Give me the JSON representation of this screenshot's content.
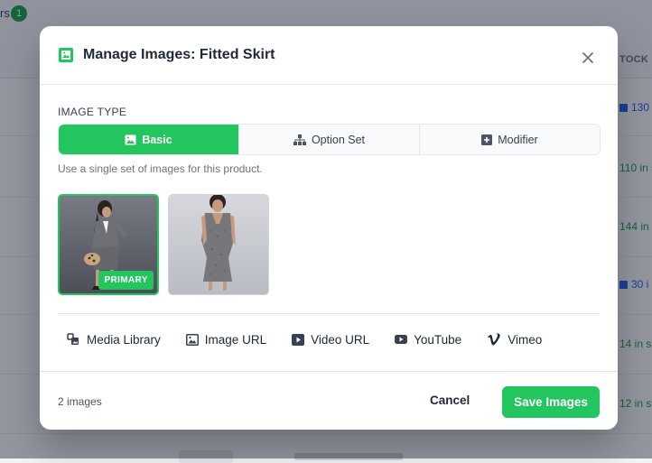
{
  "background": {
    "top_label_fragment": "rs",
    "count_badge": "1",
    "stock_header": "TOCK",
    "rows": [
      {
        "stock": "130",
        "kind": "variants"
      },
      {
        "stock": "110 in s",
        "kind": "in_stock"
      },
      {
        "stock": "144 in",
        "kind": "in_stock"
      },
      {
        "stock": "30 i",
        "kind": "variants"
      },
      {
        "stock": "14 in s",
        "kind": "in_stock"
      },
      {
        "stock": "12 in st",
        "kind": "in_stock"
      }
    ]
  },
  "modal": {
    "title": "Manage Images: Fitted Skirt",
    "close_icon": "close-icon",
    "image_type_label": "IMAGE TYPE",
    "tabs": [
      {
        "label": "Basic",
        "icon": "image-icon",
        "active": true
      },
      {
        "label": "Option Set",
        "icon": "hierarchy-icon",
        "active": false
      },
      {
        "label": "Modifier",
        "icon": "plus-square-icon",
        "active": false
      }
    ],
    "hint": "Use a single set of images for this product.",
    "images": [
      {
        "badge": "PRIMARY",
        "primary": true
      },
      {
        "badge": "",
        "primary": false
      }
    ],
    "sources": [
      {
        "label": "Media Library",
        "icon": "media-library-icon"
      },
      {
        "label": "Image URL",
        "icon": "image-icon"
      },
      {
        "label": "Video URL",
        "icon": "video-icon"
      },
      {
        "label": "YouTube",
        "icon": "youtube-icon"
      },
      {
        "label": "Vimeo",
        "icon": "vimeo-icon"
      }
    ],
    "footer": {
      "count_text": "2 images",
      "cancel_label": "Cancel",
      "save_label": "Save Images"
    }
  },
  "colors": {
    "accent": "#22c55e",
    "overlay": "rgba(15, 23, 42, 0.45)",
    "link_blue": "#2563eb"
  }
}
